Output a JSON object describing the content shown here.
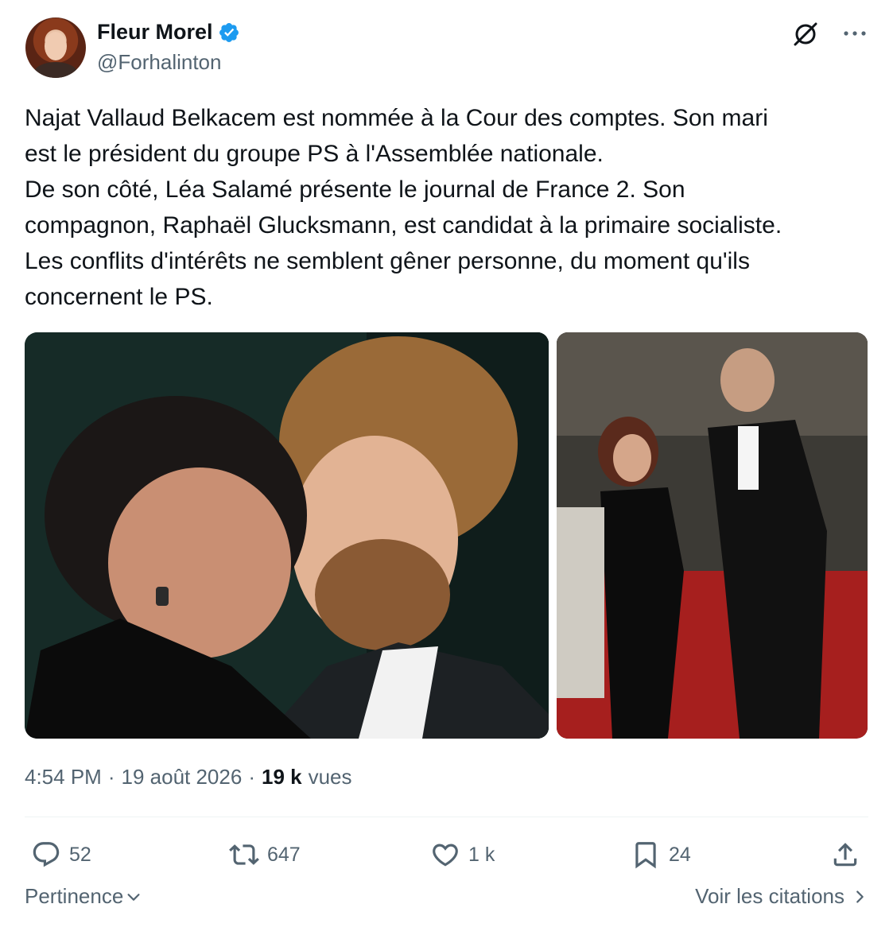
{
  "author": {
    "name": "Fleur Morel",
    "handle": "@Forhalinton",
    "verified": true,
    "verified_color": "#1d9bf0"
  },
  "tweet": {
    "lines": [
      "Najat Vallaud Belkacem est nommée à la Cour des comptes. Son mari",
      "est le président du groupe PS à l'Assemblée nationale.",
      "De son côté, Léa Salamé présente le journal de France 2. Son",
      "compagnon, Raphaël Glucksmann, est candidat à la primaire socialiste.",
      "Les conflits d'intérêts ne semblent gêner personne, du moment qu'ils",
      "concernent le PS."
    ],
    "media_count": 2
  },
  "meta": {
    "time": "4:54 PM",
    "separator": "·",
    "date": "19 août 2026",
    "views_count": "19 k",
    "views_label": "vues"
  },
  "actions": {
    "reply": {
      "icon": "reply-icon",
      "count": "52"
    },
    "retweet": {
      "icon": "retweet-icon",
      "count": "647"
    },
    "like": {
      "icon": "heart-icon",
      "count": "1 k"
    },
    "bookmark": {
      "icon": "bookmark-icon",
      "count": "24"
    },
    "share": {
      "icon": "share-icon"
    }
  },
  "footer": {
    "sort_label": "Pertinence",
    "quotes_label": "Voir les citations"
  },
  "icons": {
    "top_right": [
      "grok-icon",
      "more-icon"
    ]
  }
}
